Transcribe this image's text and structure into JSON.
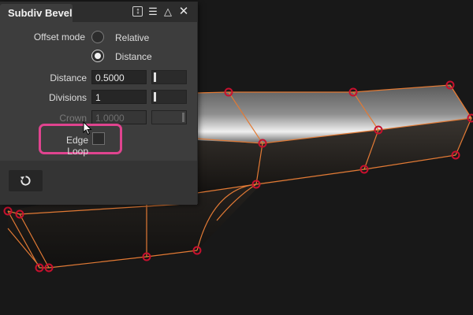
{
  "panel": {
    "title": "Subdiv Bevel",
    "offset_mode_label": "Offset mode",
    "offset_options": [
      "Relative",
      "Distance"
    ],
    "offset_selected": "Distance",
    "distance_label": "Distance",
    "distance_value": "0.5000",
    "divisions_label": "Divisions",
    "divisions_value": "1",
    "crown_label": "Crown",
    "crown_value": "1.0000",
    "edge_loop_label": "Edge Loop",
    "edge_loop_checked": false
  },
  "titlebar_icons": [
    "sort-toggle-icon",
    "menu-icon",
    "triangle-icon",
    "close-icon"
  ],
  "footer_icons": [
    "reset-icon"
  ],
  "colors": {
    "panel_bg": "#3d3d3d",
    "viewport_bg": "#181818",
    "wireframe": "#e27a35",
    "vertex": "#c8102e",
    "highlight": "#e0448f"
  }
}
